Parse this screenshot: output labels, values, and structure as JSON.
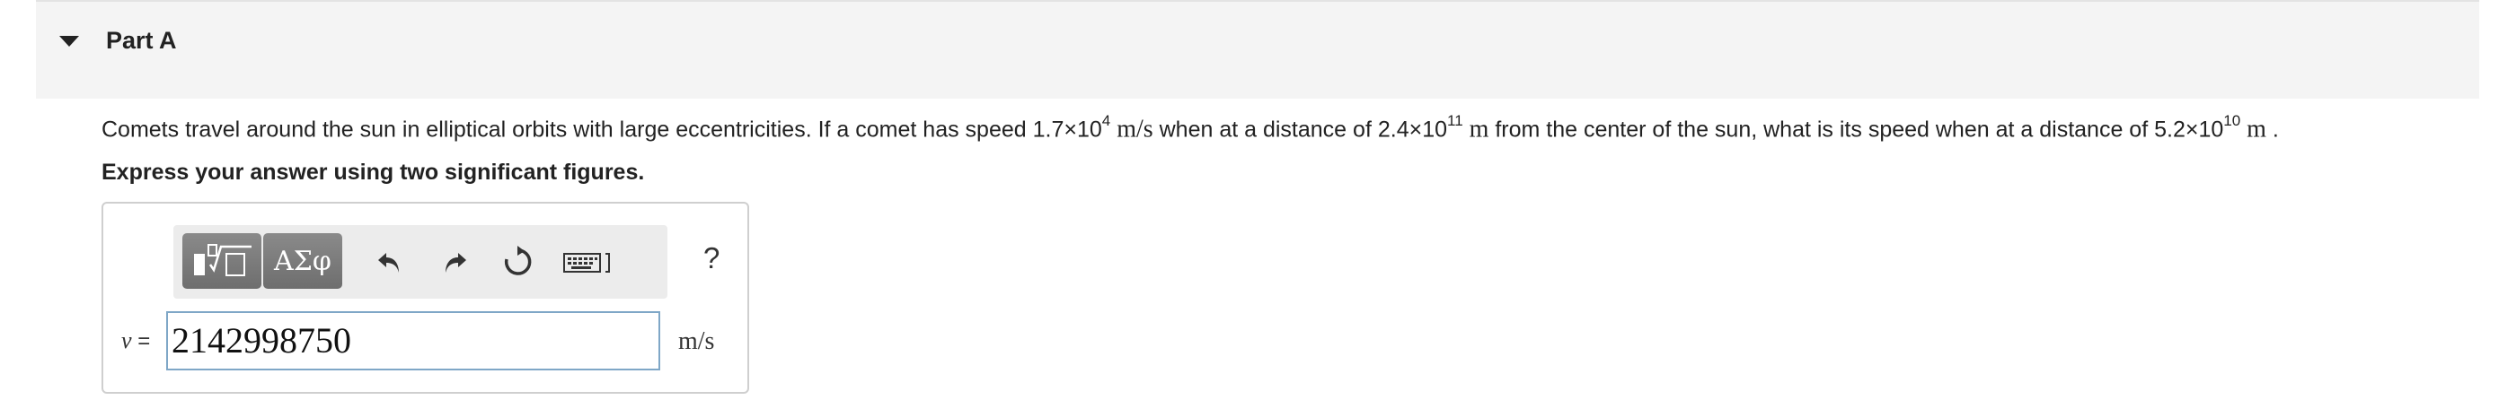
{
  "part": {
    "title": "Part A"
  },
  "question": {
    "t1": "Comets travel around the sun in elliptical orbits with large eccentricities. If a comet has speed ",
    "v_mant": "1.7×10",
    "v_exp": "4",
    "v_unit": "m/s",
    "t2": " when at a distance of ",
    "d1_mant": "2.4×10",
    "d1_exp": "11",
    "d1_unit": "m",
    "t3": " from the center of the sun, what is its speed when at a distance of ",
    "d2_mant": "5.2×10",
    "d2_exp": "10",
    "d2_unit": "m",
    "t4": " ."
  },
  "instruction": "Express your answer using two significant figures.",
  "toolbar": {
    "symbols_label": "ΑΣφ",
    "help_label": "?"
  },
  "answer": {
    "variable": "v",
    "equals": " =",
    "value": "2142998750",
    "unit": "m/s"
  }
}
